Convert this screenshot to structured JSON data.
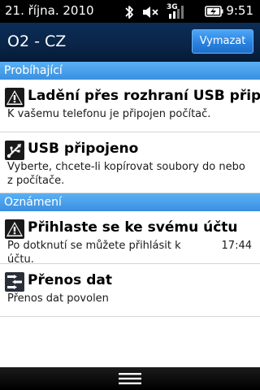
{
  "status_bar": {
    "date": "21. října. 2010",
    "time": "9:51",
    "icons": [
      "bluetooth-icon",
      "mute-icon",
      "3g-signal-icon",
      "battery-charging-icon"
    ],
    "network_label": "3G"
  },
  "header": {
    "title": "O2 - CZ",
    "clear_label": "Vymazat"
  },
  "sections": {
    "ongoing": "Probíhající",
    "notifications": "Oznámení"
  },
  "ongoing_items": [
    {
      "icon": "warning-icon",
      "title": "Ladění přes rozhraní USB připojeno",
      "text": "K vašemu telefonu je připojen počítač."
    },
    {
      "icon": "usb-icon",
      "title": "USB připojeno",
      "text": "Vyberte, chcete-li kopírovat soubory do nebo z počítače."
    }
  ],
  "notification_items": [
    {
      "icon": "warning-icon",
      "title": "Přihlaste se ke svému účtu",
      "text": "Po dotknutí se můžete přihlásit k účtu.",
      "time": "17:44"
    },
    {
      "icon": "data-transfer-icon",
      "title": "Přenos dat",
      "text": "Přenos dat povolen"
    }
  ],
  "colors": {
    "header_bg": "#0a2447",
    "section_bg": "#4aa0ea",
    "button_bg": "#2a83e0"
  }
}
